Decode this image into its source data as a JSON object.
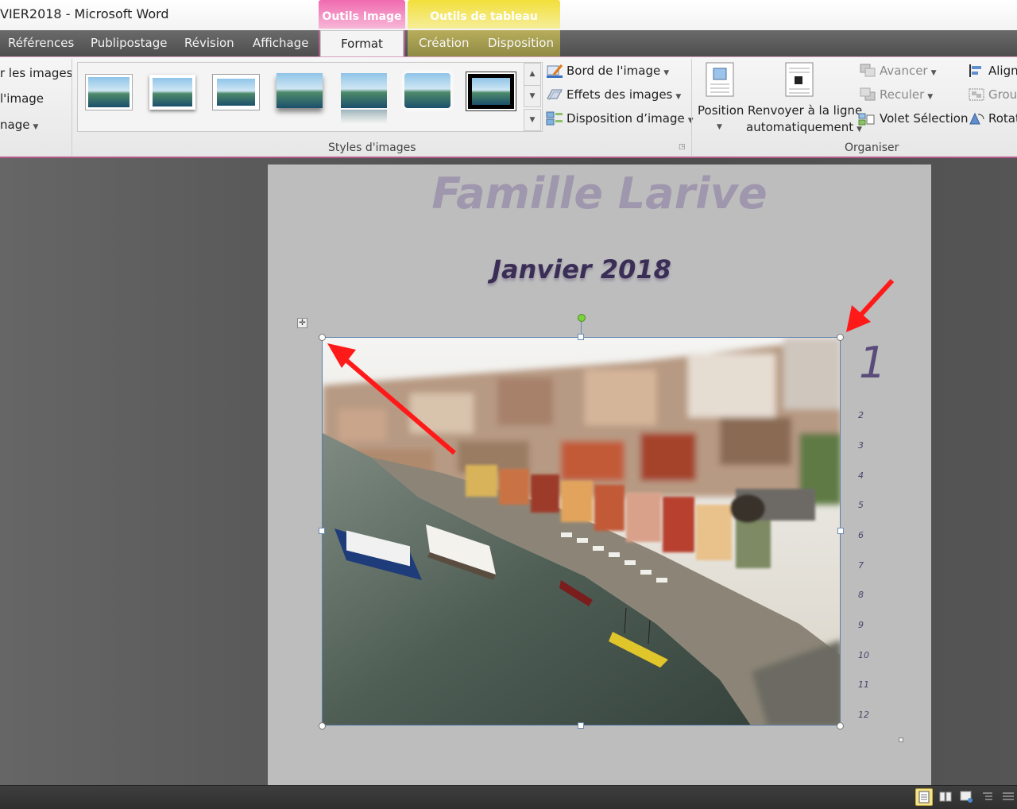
{
  "window": {
    "title": "VIER2018  -  Microsoft Word"
  },
  "context_groups": {
    "image_tools": "Outils Image",
    "table_tools": "Outils de tableau"
  },
  "tabs": {
    "references": "Références",
    "mailings": "Publipostage",
    "review": "Révision",
    "view": "Affichage",
    "format": "Format",
    "design": "Création",
    "layout": "Disposition"
  },
  "ribbon": {
    "adjust": {
      "item1": "r les images",
      "item2": "l'image",
      "item3": "nage"
    },
    "picture_styles": {
      "label": "Styles d'images",
      "border": "Bord de l'image",
      "effects": "Effets des images",
      "layout": "Disposition d’image"
    },
    "arrange": {
      "label": "Organiser",
      "position": "Position",
      "wrap_line1": "Renvoyer à la ligne",
      "wrap_line2": "automatiquement",
      "forward": "Avancer",
      "backward": "Reculer",
      "selection_pane": "Volet Sélection",
      "align": "Align",
      "group": "Grou",
      "rotate": "Rotat"
    }
  },
  "document": {
    "title": "Famille Larive",
    "subtitle": "Janvier  2018",
    "day_big": "1",
    "days": [
      "2",
      "3",
      "4",
      "5",
      "6",
      "7",
      "8",
      "9",
      "10",
      "11",
      "12"
    ]
  },
  "colors": {
    "image_tools_accent": "#f06bb0",
    "table_tools_accent": "#f2df3b",
    "page": "#bdbdbd",
    "title_text": "#9f97ad",
    "subtitle_text": "#3b2e56",
    "arrow": "#ff1a1a"
  }
}
